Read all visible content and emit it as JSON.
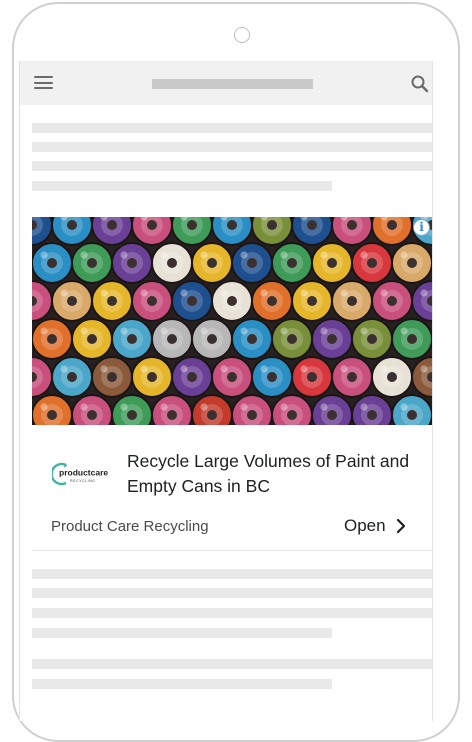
{
  "ad": {
    "headline": "Recycle Large Volumes of Paint and Empty Cans in BC",
    "advertiser": "Product Care Recycling",
    "cta": "Open",
    "logo_text_main": "productcare",
    "logo_text_sub": "RECYCLING",
    "adchoices_glyph": "i",
    "image_subject": "rows of colourful spray paint can tops"
  },
  "icons": {
    "menu": "menu-icon",
    "search": "search-icon",
    "adchoices": "adchoices-icon",
    "open": "chevron-right-icon"
  },
  "colors": {
    "topbar": "#f1f1f1",
    "skeleton": "#e9e9e9",
    "headline_text": "#202124",
    "logo_accent": "#3fb4a2"
  }
}
